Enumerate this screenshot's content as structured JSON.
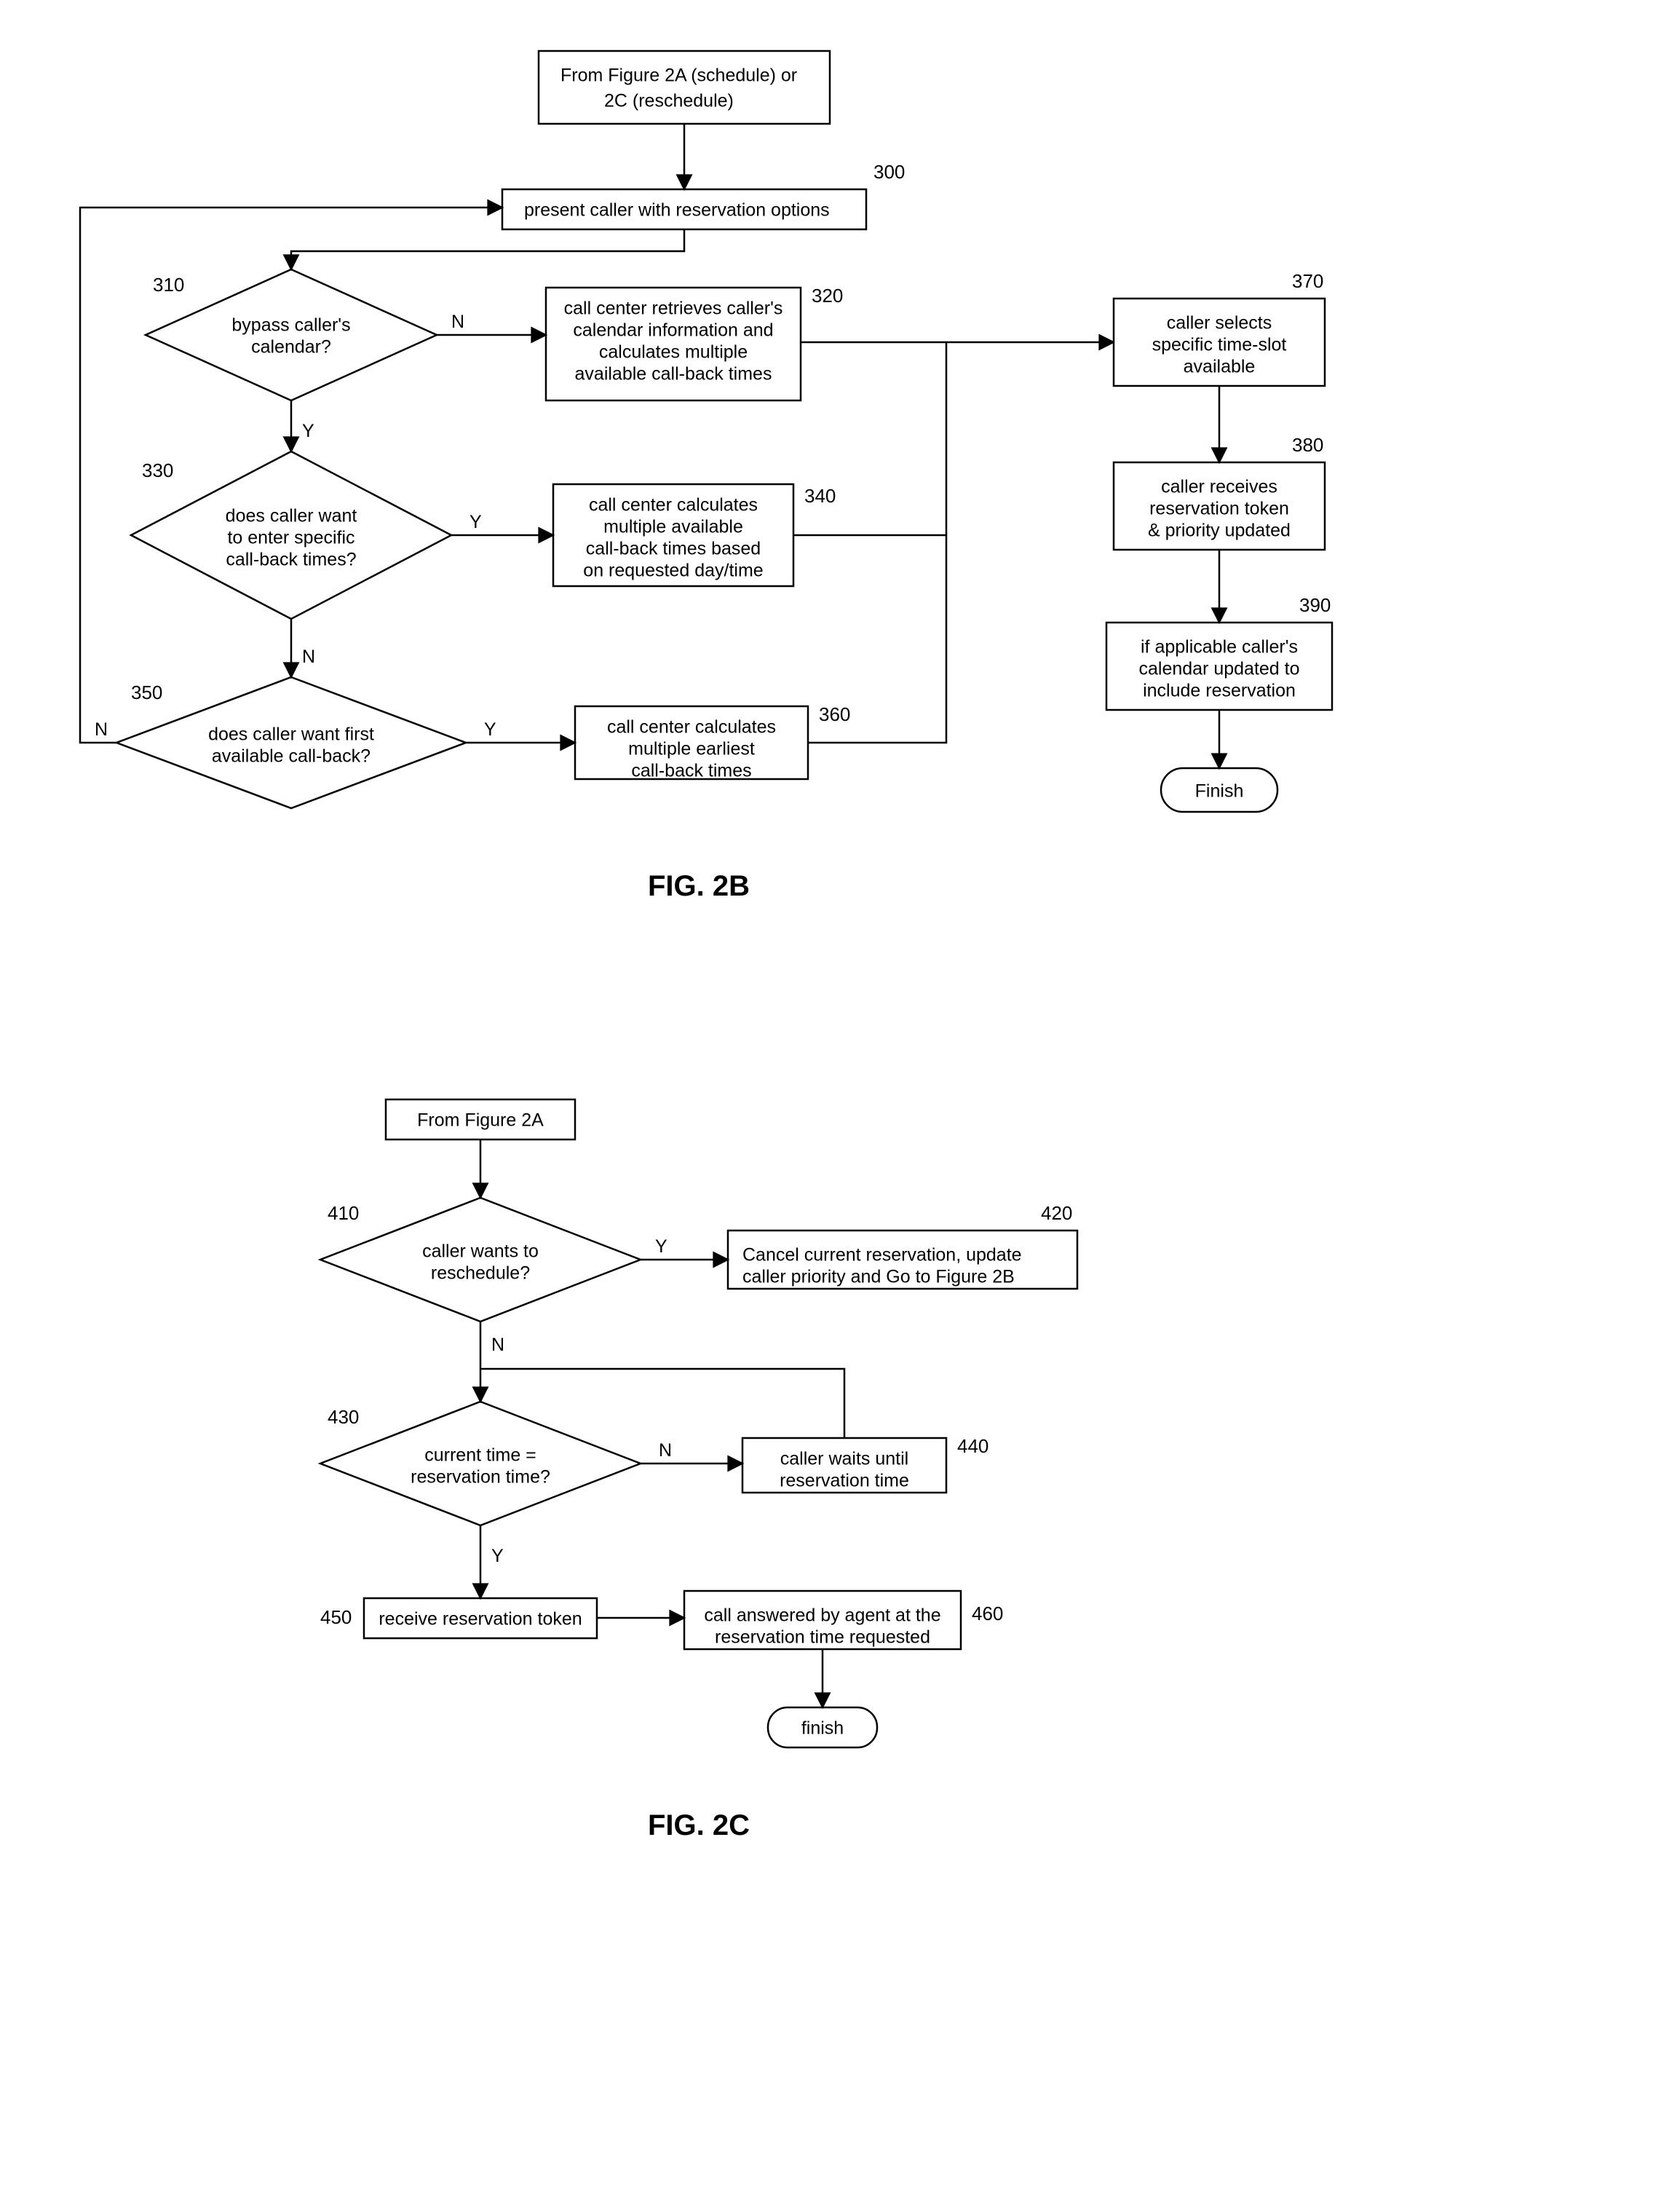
{
  "fig2b": {
    "title": "FIG. 2B",
    "nodes": {
      "start": {
        "ref": "",
        "text": "From Figure 2A (schedule) or 2C (reschedule)"
      },
      "n300": {
        "ref": "300",
        "text": "present caller with reservation options"
      },
      "n310": {
        "ref": "310",
        "text": "bypass caller's calendar?"
      },
      "n320": {
        "ref": "320",
        "text": "call center retrieves caller's calendar information and calculates multiple available call-back times"
      },
      "n330": {
        "ref": "330",
        "text": "does caller want to enter specific call-back times?"
      },
      "n340": {
        "ref": "340",
        "text": "call center calculates multiple available call-back times based on requested day/time"
      },
      "n350": {
        "ref": "350",
        "text": "does caller want first available call-back?"
      },
      "n360": {
        "ref": "360",
        "text": "call center calculates multiple earliest call-back times"
      },
      "n370": {
        "ref": "370",
        "text": "caller selects specific time-slot available"
      },
      "n380": {
        "ref": "380",
        "text": "caller receives reservation token & priority updated"
      },
      "n390": {
        "ref": "390",
        "text": "if applicable caller's calendar updated to include reservation"
      },
      "finish": {
        "ref": "",
        "text": "Finish"
      }
    },
    "edges": {
      "Y": "Y",
      "N": "N"
    }
  },
  "fig2c": {
    "title": "FIG. 2C",
    "nodes": {
      "start": {
        "ref": "",
        "text": "From Figure 2A"
      },
      "n410": {
        "ref": "410",
        "text": "caller wants to reschedule?"
      },
      "n420": {
        "ref": "420",
        "text": "Cancel current reservation, update caller priority and Go to Figure 2B"
      },
      "n430": {
        "ref": "430",
        "text": "current time = reservation time?"
      },
      "n440": {
        "ref": "440",
        "text": "caller waits until reservation time"
      },
      "n450": {
        "ref": "450",
        "text": "receive reservation token"
      },
      "n460": {
        "ref": "460",
        "text": "call answered by agent at the reservation time requested"
      },
      "finish": {
        "ref": "",
        "text": "finish"
      }
    },
    "edges": {
      "Y": "Y",
      "N": "N"
    }
  }
}
